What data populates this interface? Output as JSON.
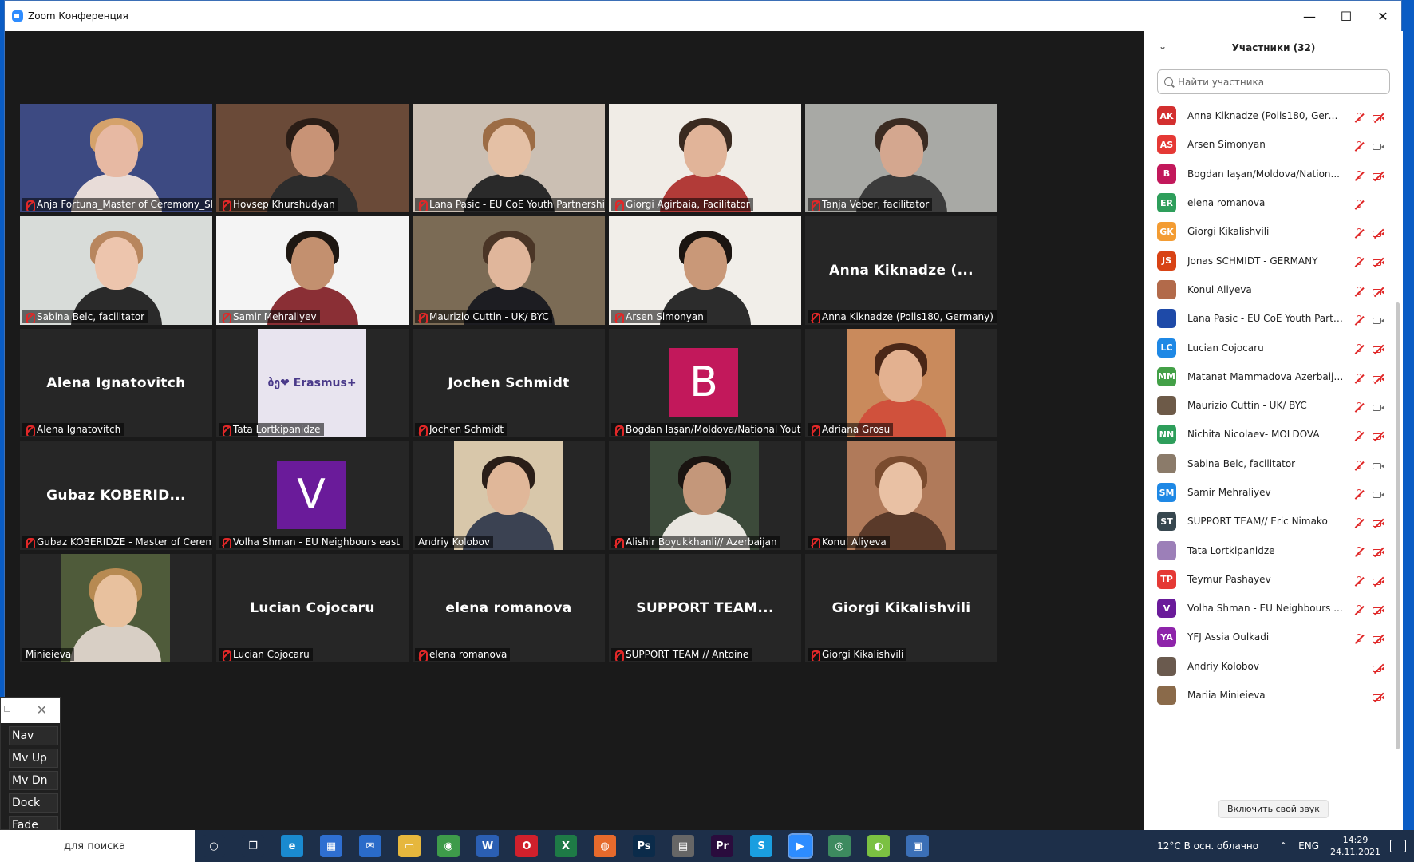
{
  "window": {
    "title": "Zoom Конференция",
    "min": "—",
    "max": "☐",
    "close": "✕"
  },
  "tiles": [
    {
      "name": "Anja Fortuna_Master of Ceremony_Slove...",
      "kind": "video",
      "bg": "#3d4a82",
      "skin": "#e7b9a3",
      "hair": "#d5a26b",
      "shirt": "#e8dcd8"
    },
    {
      "name": "Hovsep Khurshudyan",
      "kind": "video",
      "bg": "#6a4a38",
      "skin": "#c89376",
      "hair": "#2a1d16",
      "shirt": "#2c2c2c"
    },
    {
      "name": "Lana Pasic - EU CoE Youth Partnership",
      "kind": "video",
      "bg": "#cbbfb3",
      "skin": "#e4c0a5",
      "hair": "#9c6c45",
      "shirt": "#2a2a2a"
    },
    {
      "name": "Giorgi Agirbaia, Facilitator",
      "kind": "video",
      "bg": "#f0ece6",
      "skin": "#e1b499",
      "hair": "#3a2a20",
      "shirt": "#b23b38",
      "active": true
    },
    {
      "name": "Tanja Veber, facilitator",
      "kind": "video",
      "bg": "#a8a9a5",
      "skin": "#d4a78f",
      "hair": "#3a2b22",
      "shirt": "#3b3b3b"
    },
    {
      "name": "Sabina Belc, facilitator",
      "kind": "video",
      "bg": "#d8dcd9",
      "skin": "#edc5ad",
      "hair": "#b8865e",
      "shirt": "#2a2a2a"
    },
    {
      "name": "Samir Mehraliyev",
      "kind": "video",
      "bg": "#f4f4f4",
      "skin": "#c3906f",
      "hair": "#1e1712",
      "shirt": "#8a2f35"
    },
    {
      "name": "Maurizio Cuttin - UK/ BYC",
      "kind": "video",
      "bg": "#7b6b55",
      "skin": "#e0b69b",
      "hair": "#4a3526",
      "shirt": "#1d1d22"
    },
    {
      "name": "Arsen Simonyan",
      "kind": "video",
      "bg": "#f1eee9",
      "skin": "#c99878",
      "hair": "#1b1511",
      "shirt": "#2c2c2c"
    },
    {
      "name": "Anna Kiknadze (Polis180, Germany)",
      "kind": "text",
      "label": "Anna Kiknadze (..."
    },
    {
      "name": "Alena Ignatovitch",
      "kind": "text",
      "label": "Alena Ignatovitch"
    },
    {
      "name": "Tata Lortkipanidze",
      "kind": "image",
      "bg": "#e8e4ef",
      "tag": "ბე❤ Erasmus+"
    },
    {
      "name": "Jochen Schmidt",
      "kind": "text",
      "label": "Jochen Schmidt"
    },
    {
      "name": "Bogdan Iaşan/Moldova/National Youth C...",
      "kind": "avatar",
      "letter": "B",
      "color": "#c2185b"
    },
    {
      "name": "Adriana Grosu",
      "kind": "photo",
      "bg": "#c98a5c",
      "skin": "#e3b190",
      "hair": "#4a2717",
      "shirt": "#d0513c"
    },
    {
      "name": "Gubaz KOBERIDZE - Master of Ceremony",
      "kind": "text",
      "label": "Gubaz KOBERID..."
    },
    {
      "name": "Volha Shman - EU Neighbours east",
      "kind": "avatar",
      "letter": "V",
      "color": "#6a1b9a"
    },
    {
      "name": "Andriy Kolobov",
      "kind": "photo",
      "bg": "#d8c7aa",
      "skin": "#e0b799",
      "hair": "#2a1e18",
      "shirt": "#3b4252",
      "nomic": true
    },
    {
      "name": "Alishir Boyukkhanli// Azerbaijan",
      "kind": "photo",
      "bg": "#3c4a3a",
      "skin": "#c4977a",
      "hair": "#1a1411",
      "shirt": "#e9e6e0"
    },
    {
      "name": "Konul Aliyeva",
      "kind": "photo",
      "bg": "#b07a5a",
      "skin": "#e9c1a4",
      "hair": "#7a4b2e",
      "shirt": "#5a3a2a"
    },
    {
      "name": "Minieieva",
      "kind": "photo",
      "bg": "#4f5b3a",
      "skin": "#e8c19e",
      "hair": "#b78a52",
      "shirt": "#d8cfc5",
      "nomic": true
    },
    {
      "name": "Lucian Cojocaru",
      "kind": "text",
      "label": "Lucian Cojocaru"
    },
    {
      "name": "elena romanova",
      "kind": "text",
      "label": "elena romanova"
    },
    {
      "name": "SUPPORT TEAM // Antoine",
      "kind": "text",
      "label": "SUPPORT TEAM..."
    },
    {
      "name": "Giorgi Kikalishvili",
      "kind": "text",
      "label": "Giorgi Kikalishvili"
    }
  ],
  "panel": {
    "title": "Участники (32)",
    "search_placeholder": "Найти участника",
    "unmute": "Включить свой звук",
    "participants": [
      {
        "initials": "AK",
        "color": "#d32f2f",
        "name": "Anna Kiknadze (Polis180, Germ...",
        "mic": "off",
        "cam": "off"
      },
      {
        "initials": "AS",
        "color": "#e53935",
        "name": "Arsen Simonyan",
        "mic": "off",
        "cam": "on"
      },
      {
        "initials": "B",
        "color": "#c2185b",
        "name": "Bogdan Iaşan/Moldova/Nation...",
        "mic": "off",
        "cam": "off"
      },
      {
        "initials": "ER",
        "color": "#2e9e5b",
        "name": "elena romanova",
        "mic": "off",
        "cam": "none"
      },
      {
        "initials": "GK",
        "color": "#f39c33",
        "name": "Giorgi Kikalishvili",
        "mic": "off",
        "cam": "off"
      },
      {
        "initials": "JS",
        "color": "#d84315",
        "name": "Jonas SCHMIDT - GERMANY",
        "mic": "off",
        "cam": "off"
      },
      {
        "initials": "",
        "color": "#b26a4a",
        "name": "Konul Aliyeva",
        "mic": "off",
        "cam": "off"
      },
      {
        "initials": "",
        "color": "#1e4aa8",
        "name": "Lana Pasic - EU CoE Youth Partn...",
        "mic": "off",
        "cam": "on"
      },
      {
        "initials": "LC",
        "color": "#1e88e5",
        "name": "Lucian Cojocaru",
        "mic": "off",
        "cam": "off"
      },
      {
        "initials": "MM",
        "color": "#43a047",
        "name": "Matanat Mammadova Azerbaijan",
        "mic": "off",
        "cam": "off"
      },
      {
        "initials": "",
        "color": "#6d5a48",
        "name": "Maurizio Cuttin - UK/ BYC",
        "mic": "off",
        "cam": "on"
      },
      {
        "initials": "NN",
        "color": "#2e9e5b",
        "name": "Nichita Nicolaev- MOLDOVA",
        "mic": "off",
        "cam": "off"
      },
      {
        "initials": "",
        "color": "#8b7b6a",
        "name": "Sabina Belc, facilitator",
        "mic": "off",
        "cam": "on"
      },
      {
        "initials": "SM",
        "color": "#1e88e5",
        "name": "Samir Mehraliyev",
        "mic": "off",
        "cam": "on"
      },
      {
        "initials": "ST",
        "color": "#37474f",
        "name": "SUPPORT TEAM// Eric Nimako",
        "mic": "off",
        "cam": "off"
      },
      {
        "initials": "",
        "color": "#9c7fb8",
        "name": "Tata Lortkipanidze",
        "mic": "off",
        "cam": "off"
      },
      {
        "initials": "TP",
        "color": "#e53935",
        "name": "Teymur Pashayev",
        "mic": "off",
        "cam": "off"
      },
      {
        "initials": "V",
        "color": "#6a1b9a",
        "name": "Volha Shman - EU Neighbours ...",
        "mic": "off",
        "cam": "off"
      },
      {
        "initials": "YA",
        "color": "#8e24aa",
        "name": "YFJ Assia Oulkadi",
        "mic": "off",
        "cam": "off"
      },
      {
        "initials": "",
        "color": "#6a5a4e",
        "name": "Andriy Kolobov",
        "mic": "none",
        "cam": "off"
      },
      {
        "initials": "",
        "color": "#8a6a4a",
        "name": "Mariia Minieieva",
        "mic": "none",
        "cam": "off"
      }
    ]
  },
  "navbox": {
    "buttons": [
      "Nav",
      "Mv Up",
      "Mv Dn",
      "Dock",
      "Fade"
    ]
  },
  "taskbar": {
    "search_text": "для поиска",
    "apps": [
      {
        "icon": "cortana-icon",
        "glyph": "○",
        "color": "#1d2f49"
      },
      {
        "icon": "task-view-icon",
        "glyph": "❐",
        "color": "#1d2f49"
      },
      {
        "icon": "edge-icon",
        "glyph": "e",
        "color": "#1a8ad0"
      },
      {
        "icon": "store-icon",
        "glyph": "▦",
        "color": "#2f6fd1"
      },
      {
        "icon": "mail-icon",
        "glyph": "✉",
        "color": "#2a6bc9"
      },
      {
        "icon": "explorer-icon",
        "glyph": "▭",
        "color": "#e6b73d"
      },
      {
        "icon": "chrome-icon",
        "glyph": "◉",
        "color": "#3e9b4a"
      },
      {
        "icon": "word-icon",
        "glyph": "W",
        "color": "#2b5fb3"
      },
      {
        "icon": "opera-icon",
        "glyph": "O",
        "color": "#d1202c"
      },
      {
        "icon": "excel-icon",
        "glyph": "X",
        "color": "#1e7a46"
      },
      {
        "icon": "firefox-icon",
        "glyph": "◍",
        "color": "#e66a2c"
      },
      {
        "icon": "photoshop-icon",
        "glyph": "Ps",
        "color": "#0b2b4a"
      },
      {
        "icon": "calculator-icon",
        "glyph": "▤",
        "color": "#666"
      },
      {
        "icon": "premiere-icon",
        "glyph": "Pr",
        "color": "#2a0c3d"
      },
      {
        "icon": "skype-icon",
        "glyph": "S",
        "color": "#1a9ee0"
      },
      {
        "icon": "zoom-icon",
        "glyph": "▶",
        "color": "#2d8cff",
        "active": true
      },
      {
        "icon": "globe-icon",
        "glyph": "◎",
        "color": "#3d8a5f"
      },
      {
        "icon": "app-icon",
        "glyph": "◐",
        "color": "#7bc142"
      },
      {
        "icon": "remote-icon",
        "glyph": "▣",
        "color": "#3b6fb6"
      }
    ],
    "weather": "12°C  В осн. облачно",
    "lang": "ENG",
    "time": "14:29",
    "date": "24.11.2021"
  }
}
